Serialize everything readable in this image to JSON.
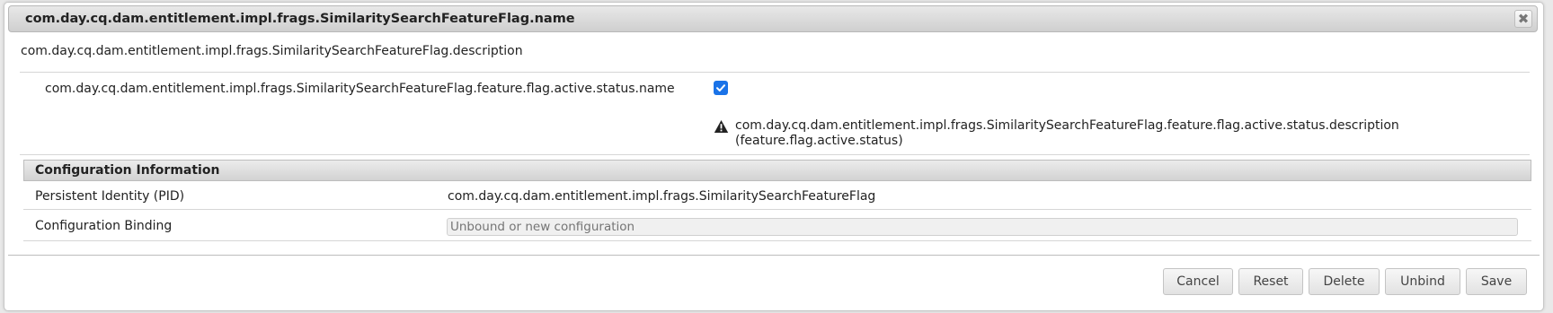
{
  "dialog": {
    "title": "com.day.cq.dam.entitlement.impl.frags.SimilaritySearchFeatureFlag.name",
    "close_symbol": "✖",
    "description": "com.day.cq.dam.entitlement.impl.frags.SimilaritySearchFeatureFlag.description"
  },
  "property": {
    "name": "com.day.cq.dam.entitlement.impl.frags.SimilaritySearchFeatureFlag.feature.flag.active.status.name",
    "checked": true,
    "description": "com.day.cq.dam.entitlement.impl.frags.SimilaritySearchFeatureFlag.feature.flag.active.status.description",
    "key": "(feature.flag.active.status)"
  },
  "config_info": {
    "header": "Configuration Information",
    "pid_label": "Persistent Identity (PID)",
    "pid_value": "com.day.cq.dam.entitlement.impl.frags.SimilaritySearchFeatureFlag",
    "binding_label": "Configuration Binding",
    "binding_placeholder": "Unbound or new configuration"
  },
  "buttons": {
    "cancel": "Cancel",
    "reset": "Reset",
    "delete": "Delete",
    "unbind": "Unbind",
    "save": "Save"
  },
  "icons": {
    "close": "close-icon",
    "check": "checkmark-icon",
    "warning": "warning-triangle-icon"
  },
  "colors": {
    "checkbox": "#1a73e8",
    "title_bar": "#d8d8d8"
  }
}
